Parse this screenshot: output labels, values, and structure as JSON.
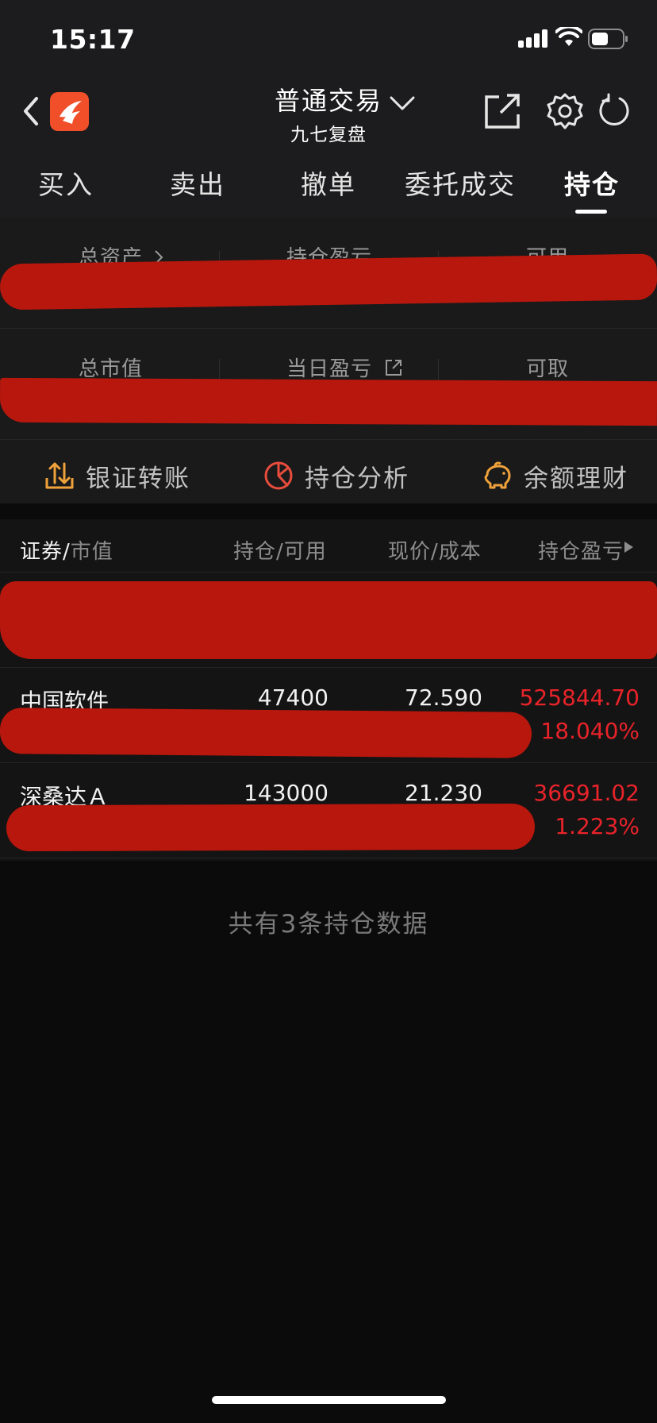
{
  "status_bar": {
    "time": "15:17"
  },
  "header": {
    "title": "普通交易",
    "subtitle": "九七复盘"
  },
  "tabs": [
    "买入",
    "卖出",
    "撤单",
    "委托成交",
    "持仓"
  ],
  "summary": {
    "total_assets_label": "总资产",
    "position_pnl_label": "持仓盈亏",
    "available_label": "可用",
    "market_value_label": "总市值",
    "daily_pnl_label": "当日盈亏",
    "withdrawable_label": "可取"
  },
  "tools": {
    "bank_transfer": "银证转账",
    "position_analysis": "持仓分析",
    "balance_finance": "余额理财"
  },
  "table_header": {
    "security": "证券",
    "slash1": "/",
    "market_value": "市值",
    "holdings_available": "持仓/可用",
    "price_cost": "现价/成本",
    "position_pnl": "持仓盈亏"
  },
  "holdings": [
    {
      "name": "中国软件",
      "quantity": "47400",
      "price": "72.590",
      "pnl": "525844.70",
      "pnl_percent": "18.040%"
    },
    {
      "name": "深桑达Ａ",
      "quantity": "143000",
      "price": "21.230",
      "pnl": "36691.02",
      "pnl_percent": "1.223%"
    }
  ],
  "footer": "共有3条持仓数据",
  "colors": {
    "accent_red": "#e8232a",
    "redaction": "#b8170d",
    "logo": "#f04f2a",
    "tool_icon_orange": "#f0a23a",
    "tool_icon_red": "#e84c3d"
  }
}
